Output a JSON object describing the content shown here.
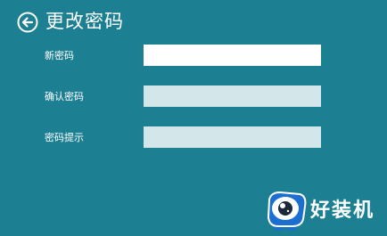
{
  "header": {
    "title": "更改密码",
    "back_icon": "back-arrow-circle-icon"
  },
  "form": {
    "fields": [
      {
        "label": "新密码",
        "value": "",
        "state": "focused"
      },
      {
        "label": "确认密码",
        "value": "",
        "state": "inactive"
      },
      {
        "label": "密码提示",
        "value": "",
        "state": "inactive"
      }
    ]
  },
  "watermark": {
    "text": "好装机",
    "mascot_icon": "mascot-logo-icon"
  },
  "colors": {
    "background": "#1c7f92",
    "input_focused": "#ffffff",
    "input_inactive": "#d3e6ea",
    "mascot_blue": "#1a6fd1"
  }
}
